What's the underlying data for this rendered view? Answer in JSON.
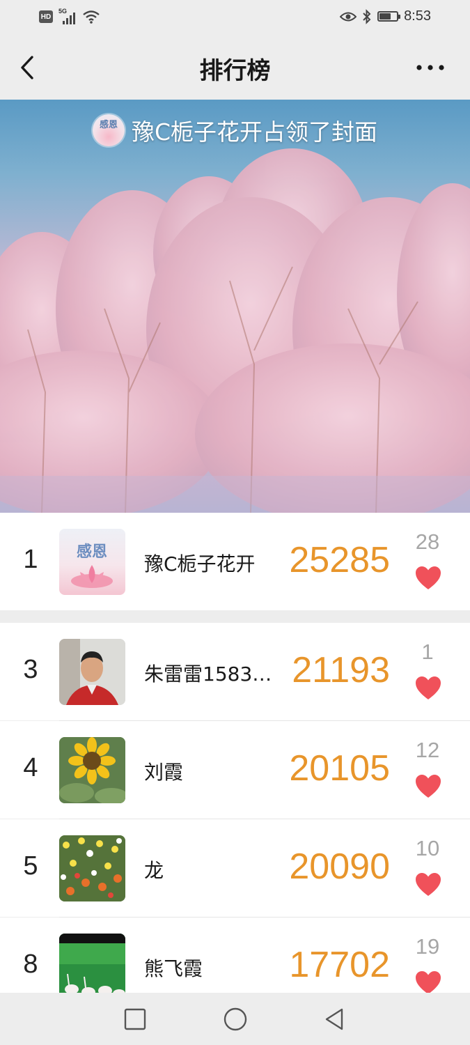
{
  "status_bar": {
    "hd": "HD",
    "network": "5G",
    "time": "8:53",
    "battery_level": 0.6
  },
  "nav": {
    "title": "排行榜",
    "back_icon": "chevron-left-icon",
    "more_icon": "more-dots-icon"
  },
  "cover": {
    "caption": "豫C栀子花开占领了封面",
    "avatar_text": "感恩"
  },
  "ranking": [
    {
      "rank": "1",
      "name": "豫C栀子花开",
      "steps": "25285",
      "likes": "28",
      "avatar": "lotus-avatar"
    },
    {
      "rank": "3",
      "name": "朱雷雷1583…",
      "steps": "21193",
      "likes": "1",
      "avatar": "portrait-avatar"
    },
    {
      "rank": "4",
      "name": "刘霞",
      "steps": "20105",
      "likes": "12",
      "avatar": "sunflower-avatar"
    },
    {
      "rank": "5",
      "name": "龙",
      "steps": "20090",
      "likes": "10",
      "avatar": "flowers-avatar"
    },
    {
      "rank": "8",
      "name": "熊飞霞",
      "steps": "17702",
      "likes": "19",
      "avatar": "flamingo-avatar"
    }
  ],
  "colors": {
    "steps": "#e8952b",
    "heart": "#f0515a",
    "likes": "#a6a6a6",
    "background": "#ededed"
  }
}
